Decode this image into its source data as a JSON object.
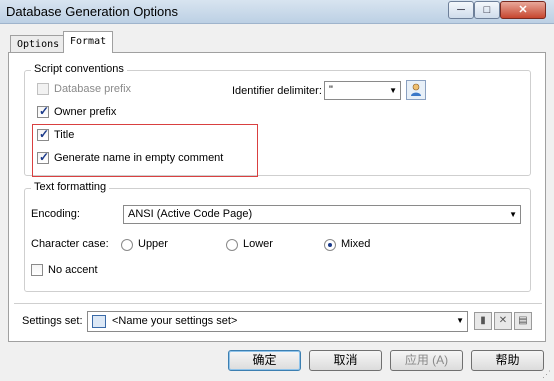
{
  "window": {
    "title": "Database Generation Options",
    "min_glyph": "─",
    "max_glyph": "□",
    "close_glyph": "✕"
  },
  "tabs": [
    {
      "label": "Options"
    },
    {
      "label": "Format"
    }
  ],
  "script_conventions": {
    "group_label": "Script conventions",
    "database_prefix": {
      "label": "Database prefix",
      "checked": false,
      "enabled": false
    },
    "owner_prefix": {
      "label": "Owner prefix",
      "checked": true
    },
    "title": {
      "label": "Title",
      "checked": true
    },
    "generate_name": {
      "label": "Generate name in empty comment",
      "checked": true
    },
    "identifier_delimiter": {
      "label": "Identifier delimiter:",
      "value": "\""
    }
  },
  "text_formatting": {
    "group_label": "Text formatting",
    "encoding": {
      "label": "Encoding:",
      "value": "ANSI (Active Code Page)"
    },
    "character_case": {
      "label": "Character case:",
      "options": [
        "Upper",
        "Lower",
        "Mixed"
      ],
      "selected": "Mixed"
    },
    "no_accent": {
      "label": "No accent",
      "checked": false
    }
  },
  "settings_set": {
    "label": "Settings set:",
    "value": "<Name your settings set>"
  },
  "buttons": {
    "ok": "确定",
    "cancel": "取消",
    "apply": "应用 (A)",
    "help": "帮助"
  },
  "colors": {
    "highlight_border": "#d94040",
    "accent": "#1b3a8a"
  }
}
